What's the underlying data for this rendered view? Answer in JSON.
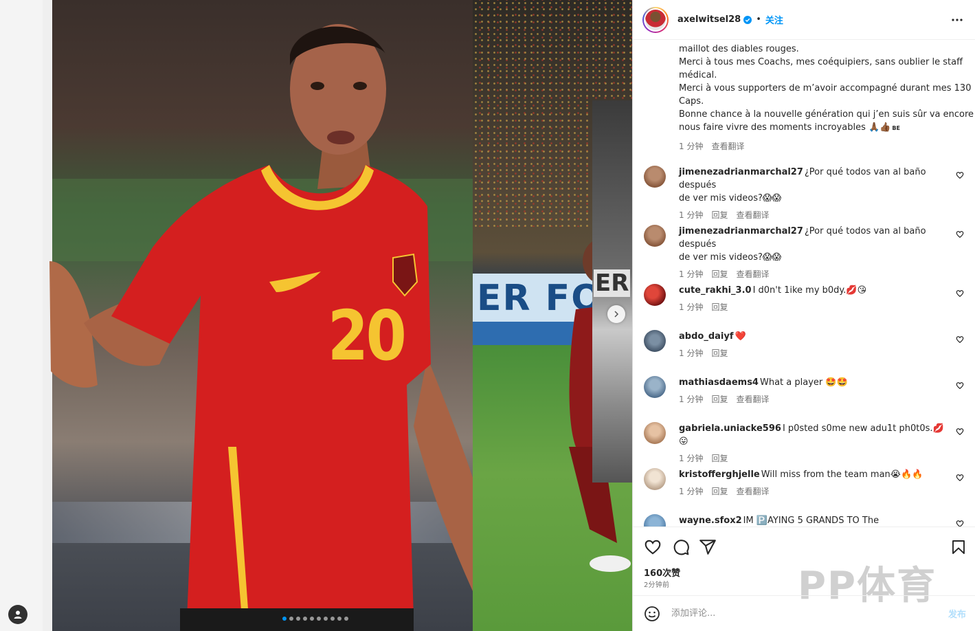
{
  "header": {
    "username": "axelwitsel28",
    "bullet": "•",
    "follow_label": "关注"
  },
  "caption": {
    "lines": [
      "maillot des diables rouges.",
      "Merci à tous mes Coachs, mes coéquipiers, sans oublier le staff",
      "médical.",
      "Merci à vous supporters de m’avoir accompagné durant mes 130",
      "Caps.",
      "Bonne chance à la nouvelle génération qui j’en suis sûr va encore",
      "nous faire vivre des moments incroyables 🙏🏾👍🏾"
    ],
    "flag_text": "BE",
    "time": "1 分钟",
    "translate": "查看翻译"
  },
  "comments": [
    {
      "user": "jimenezadrianmarchal27",
      "text": "¿Por qué todos van al baño después",
      "text2": "de ver mis videos?😱😱",
      "time": "1 分钟",
      "reply": "回复",
      "translate": "查看翻译"
    },
    {
      "user": "jimenezadrianmarchal27",
      "text": "¿Por qué todos van al baño después",
      "text2": "de ver mis videos?😱😱",
      "time": "1 分钟",
      "reply": "回复",
      "translate": "查看翻译"
    },
    {
      "user": "cute_rakhi_3.0",
      "text": "I d0n't 1ike my b0dy.💋😘",
      "text2": "",
      "time": "1 分钟",
      "reply": "回复",
      "translate": ""
    },
    {
      "user": "abdo_daiyf",
      "text": "❤️",
      "text2": "",
      "time": "1 分钟",
      "reply": "回复",
      "translate": ""
    },
    {
      "user": "mathiasdaems4",
      "text": "What a player 🤩🤩",
      "text2": "",
      "time": "1 分钟",
      "reply": "回复",
      "translate": "查看翻译"
    },
    {
      "user": "gabriela.uniacke596",
      "text": "I p0sted s0me new adu1t ph0t0s.💋😛",
      "text2": "",
      "time": "1 分钟",
      "reply": "回复",
      "translate": ""
    },
    {
      "user": "kristofferghjelle",
      "text": "Will miss from the team man😭🔥🔥",
      "text2": "",
      "time": "1 分钟",
      "reply": "回复",
      "translate": "查看翻译"
    },
    {
      "user": "wayne.sfox2",
      "text": "IM 🅿️AYING 5 GRANDS TO The",
      "text2": "",
      "time": "",
      "reply": "",
      "translate": ""
    }
  ],
  "actions": {
    "likes": "160次赞",
    "posted_time": "2分钟前"
  },
  "comment_box": {
    "placeholder": "添加评论...",
    "post_label": "发布"
  },
  "media": {
    "jersey_number": "20",
    "ad_text": "ER FO",
    "ad_text2": "ER",
    "slide_count": 10,
    "active_slide": 0
  },
  "watermark": "PP体育",
  "colors": {
    "link_blue": "#0095f6",
    "post_disabled": "#b2dffc",
    "jersey_red": "#d41f1f",
    "jersey_yellow": "#f5c431"
  }
}
